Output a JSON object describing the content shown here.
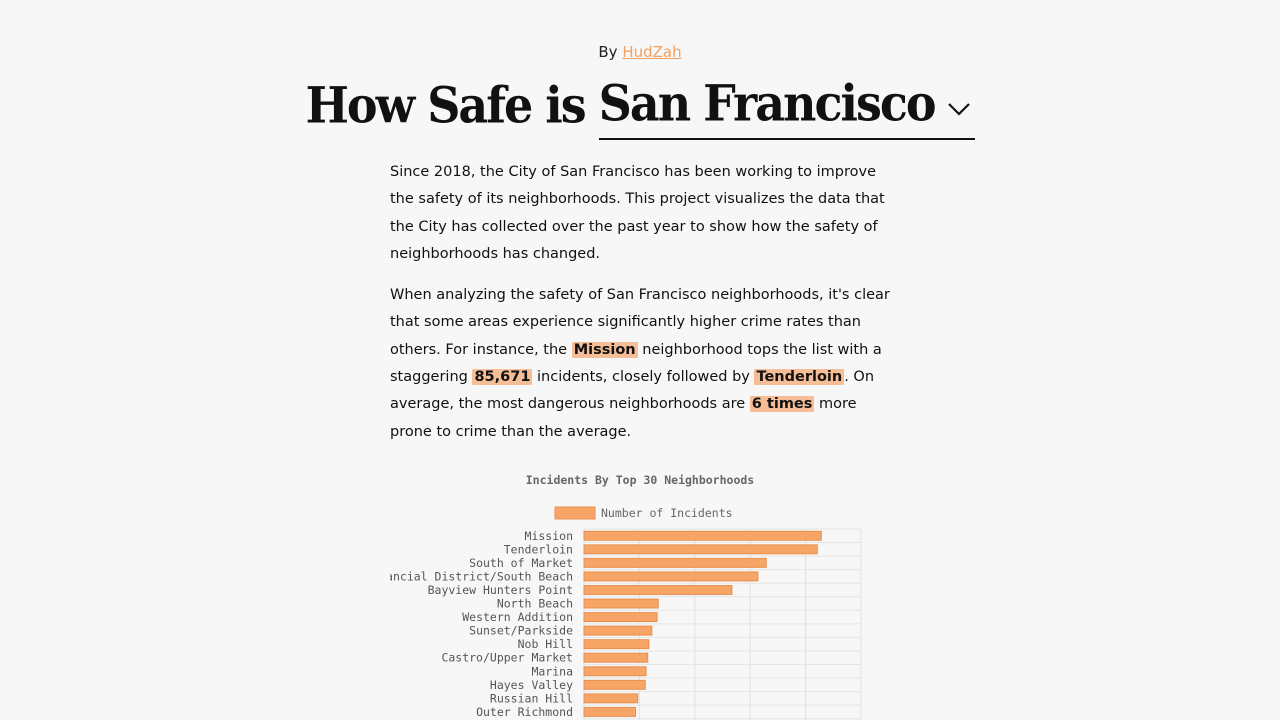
{
  "byline": {
    "prefix": "By",
    "author": "HudZah"
  },
  "title": {
    "prefix": "How Safe is",
    "city": "San Francisco",
    "dropdown_icon": "chevron-down-icon"
  },
  "article": {
    "p1": "Since 2018, the City of San Francisco has been working to improve the safety of its neighborhoods. This project visualizes the data that the City has collected over the past year to show how the safety of neighborhoods has changed.",
    "p2_a": "When analyzing the safety of San Francisco neighborhoods, it's clear that some areas experience significantly higher crime rates than others. For instance, the",
    "top_neighborhood": "Mission",
    "p2_b": "neighborhood tops the list with a staggering",
    "top_count": "85,671",
    "p2_c": "incidents, closely followed by",
    "second_neighborhood": "Tenderloin",
    "p2_d": ". On average, the most dangerous neighborhoods are",
    "multiplier": "6 times",
    "p2_e": "more prone to crime than the average."
  },
  "colors": {
    "accent": "#f7a567",
    "highlight": "#f6be96",
    "link": "#f0a060",
    "background": "#f7f7f7"
  },
  "chart_data": {
    "type": "bar",
    "orientation": "horizontal",
    "title": "Incidents By Top 30 Neighborhoods",
    "legend": "top",
    "grid": true,
    "xlim": [
      0,
      100000
    ],
    "categories": [
      "Mission",
      "Tenderloin",
      "South of Market",
      "Financial District/South Beach",
      "Bayview Hunters Point",
      "North Beach",
      "Western Addition",
      "Sunset/Parkside",
      "Nob Hill",
      "Castro/Upper Market",
      "Marina",
      "Hayes Valley",
      "Russian Hill",
      "Outer Richmond"
    ],
    "series": [
      {
        "name": "Number of Incidents",
        "values": [
          85671,
          84200,
          65800,
          62800,
          53400,
          26800,
          26400,
          24500,
          23400,
          23000,
          22400,
          22100,
          19400,
          18600
        ]
      }
    ]
  }
}
